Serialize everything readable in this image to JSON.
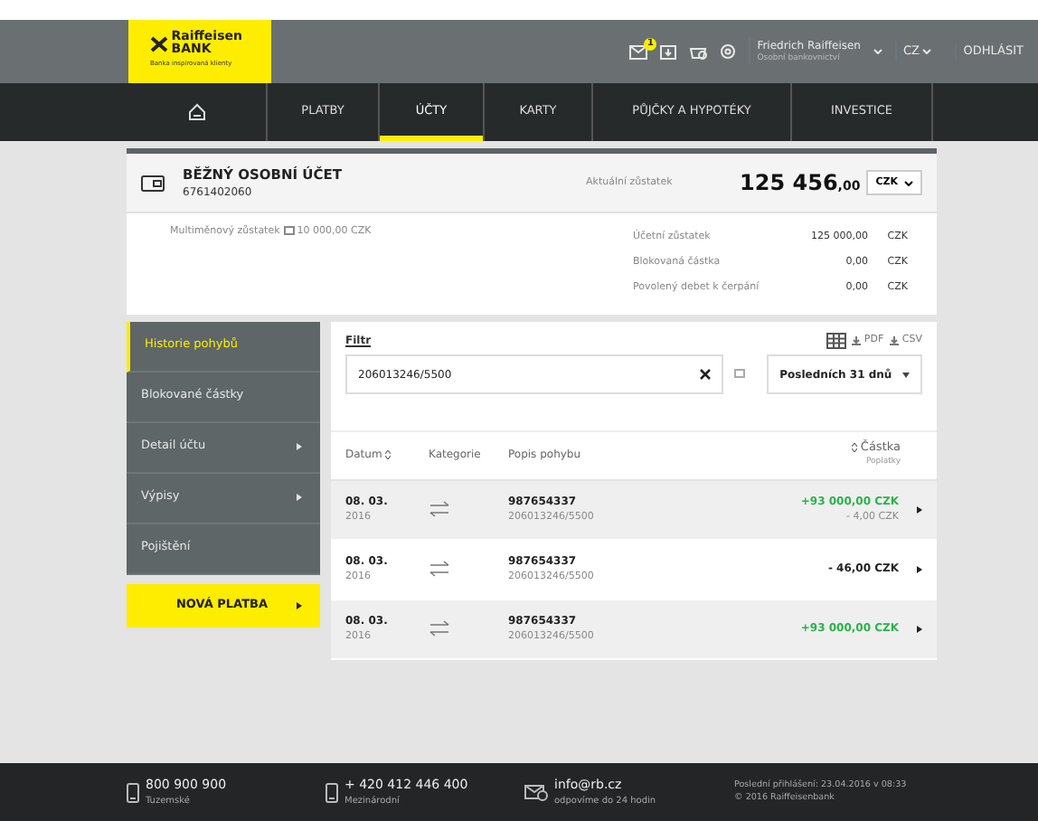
{
  "header": {
    "logo": {
      "name": "Raiffeisen",
      "subname": "BANK",
      "tagline": "Banka inspirovaná klienty"
    },
    "notifications": "1",
    "user": {
      "name": "Friedrich Raiffeisen",
      "role": "Osobní bankovnictví"
    },
    "language": "CZ",
    "logout": "ODHLÁSIT"
  },
  "nav": [
    {
      "kind": "home",
      "selected": false
    },
    {
      "kind": "text",
      "label": "PLATBY",
      "selected": false
    },
    {
      "kind": "text",
      "label": "ÚČTY",
      "selected": true
    },
    {
      "kind": "text",
      "label": "KARTY",
      "selected": false
    },
    {
      "kind": "text",
      "label": "PŮJČKY A HYPOTÉKY",
      "selected": false
    },
    {
      "kind": "text",
      "label": "INVESTICE",
      "selected": false
    }
  ],
  "account": {
    "title": "BĚŽNÝ OSOBNÍ ÚČET",
    "number": "6761402060",
    "balance_label": "Aktuální zůstatek",
    "balance_main": "125 456",
    "balance_decimals": ",00",
    "currency": "CZK",
    "multi_label": "Multiměnový zůstatek",
    "multi_value": "10 000,00 CZK",
    "details": [
      {
        "label": "Účetní zůstatek",
        "value": "125 000,00",
        "currency": "CZK"
      },
      {
        "label": "Blokovaná částka",
        "value": "0,00",
        "currency": "CZK"
      },
      {
        "label": "Povolený debet k čerpání",
        "value": "0,00",
        "currency": "CZK"
      }
    ]
  },
  "sidebar": {
    "items": [
      {
        "label": "Historie pohybů",
        "selected": true,
        "submenu": false
      },
      {
        "label": "Blokované částky",
        "selected": false,
        "submenu": false
      },
      {
        "label": "Detail účtu",
        "selected": false,
        "submenu": true
      },
      {
        "label": "Výpisy",
        "selected": false,
        "submenu": true
      },
      {
        "label": "Pojištění",
        "selected": false,
        "submenu": false
      }
    ],
    "new_payment": "NOVÁ PLATBA"
  },
  "filter": {
    "title": "Filtr",
    "exports": [
      "PDF",
      "CSV"
    ],
    "search_value": "206013246/5500",
    "period": "Posledních 31 dnů"
  },
  "table": {
    "columns": [
      "Datum",
      "Kategorie",
      "Popis pohybu",
      "Částka"
    ],
    "fee_column": "Poplatky",
    "rows": [
      {
        "date": "08. 03.",
        "year": "2016",
        "name": "987654337",
        "account": "206013246/5500",
        "amount": "+93 000,00 CZK",
        "kind": "credit",
        "fee": "- 4,00 CZK"
      },
      {
        "date": "08. 03.",
        "year": "2016",
        "name": "987654337",
        "account": "206013246/5500",
        "amount": "- 46,00 CZK",
        "kind": "debit"
      },
      {
        "date": "08. 03.",
        "year": "2016",
        "name": "987654337",
        "account": "206013246/5500",
        "amount": "+93 000,00 CZK",
        "kind": "credit"
      }
    ]
  },
  "footer": {
    "contacts": [
      {
        "kind": "phone",
        "value": "800 900 900",
        "note": "Tuzemské"
      },
      {
        "kind": "phone",
        "value": "+ 420 412 446 400",
        "note": "Mezinárodní"
      },
      {
        "kind": "mail",
        "value": "info@rb.cz",
        "note": "odpovíme do 24 hodin"
      }
    ],
    "last_login": "Poslední přihlášení: 23.04.2016 v 08:33",
    "copyright": "© 2016 Raiffeisenbank"
  }
}
